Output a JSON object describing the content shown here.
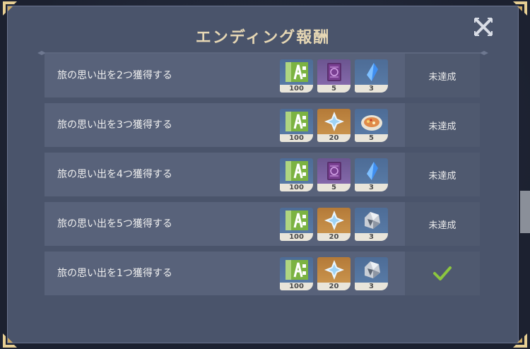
{
  "title": "エンディング報酬",
  "rows": [
    {
      "label": "旅の思い出を2つ獲得する",
      "status": "未達成",
      "completed": false,
      "rewards": [
        {
          "icon": "adventure-exp-icon",
          "count": "100",
          "rarity": "blue"
        },
        {
          "icon": "purple-book-icon",
          "count": "5",
          "rarity": "purple"
        },
        {
          "icon": "blue-crystal-icon",
          "count": "3",
          "rarity": "blue"
        }
      ]
    },
    {
      "label": "旅の思い出を3つ獲得する",
      "status": "未達成",
      "completed": false,
      "rewards": [
        {
          "icon": "adventure-exp-icon",
          "count": "100",
          "rarity": "blue"
        },
        {
          "icon": "primogem-icon",
          "count": "20",
          "rarity": "gold"
        },
        {
          "icon": "food-plate-icon",
          "count": "5",
          "rarity": "blue"
        }
      ]
    },
    {
      "label": "旅の思い出を4つ獲得する",
      "status": "未達成",
      "completed": false,
      "rewards": [
        {
          "icon": "adventure-exp-icon",
          "count": "100",
          "rarity": "blue"
        },
        {
          "icon": "purple-book-icon",
          "count": "5",
          "rarity": "purple"
        },
        {
          "icon": "blue-crystal-icon",
          "count": "3",
          "rarity": "blue"
        }
      ]
    },
    {
      "label": "旅の思い出を5つ獲得する",
      "status": "未達成",
      "completed": false,
      "rewards": [
        {
          "icon": "adventure-exp-icon",
          "count": "100",
          "rarity": "blue"
        },
        {
          "icon": "primogem-icon",
          "count": "20",
          "rarity": "gold"
        },
        {
          "icon": "ore-icon",
          "count": "3",
          "rarity": "blue"
        }
      ]
    },
    {
      "label": "旅の思い出を1つ獲得する",
      "status": "",
      "completed": true,
      "rewards": [
        {
          "icon": "adventure-exp-icon",
          "count": "100",
          "rarity": "blue"
        },
        {
          "icon": "primogem-icon",
          "count": "20",
          "rarity": "gold"
        },
        {
          "icon": "ore-icon",
          "count": "3",
          "rarity": "blue"
        }
      ]
    }
  ],
  "colors": {
    "title": "#e6d7b4",
    "check": "#8cc63f",
    "panel": "#4a546b",
    "row": "#58627a"
  }
}
